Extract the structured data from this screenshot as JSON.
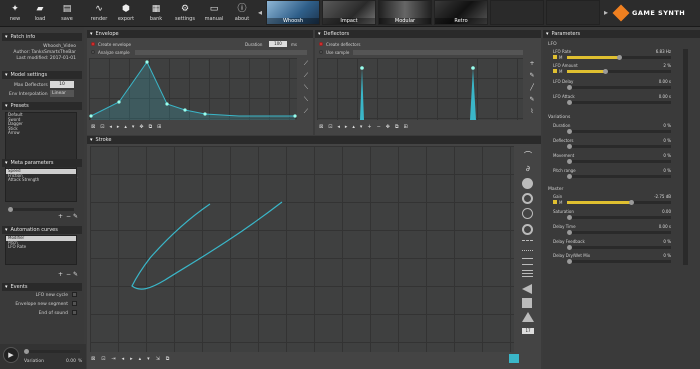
{
  "toolbar": {
    "buttons": [
      {
        "label": "new",
        "icon": "✦"
      },
      {
        "label": "load",
        "icon": "▰"
      },
      {
        "label": "save",
        "icon": "▤"
      },
      {
        "label": "render",
        "icon": "∿"
      },
      {
        "label": "export",
        "icon": "⬢"
      },
      {
        "label": "bank",
        "icon": "▦"
      },
      {
        "label": "settings",
        "icon": "⚙"
      },
      {
        "label": "manual",
        "icon": "▭"
      },
      {
        "label": "about",
        "icon": "ⓘ"
      }
    ],
    "categories": [
      "Whoosh",
      "Impact",
      "Modular",
      "Retro"
    ],
    "brand": "GAME SYNTH"
  },
  "patch_info": {
    "title": "Patch info",
    "name": "Whoosh_Video",
    "author": "Author: TanksSmartsTheBar",
    "modified": "Last modified: 2017-01-01"
  },
  "model_settings": {
    "title": "Model settings",
    "max_deflectors_label": "Max Deflectors",
    "max_deflectors_value": "10",
    "env_interp_label": "Env Interpolation",
    "env_interp_value": "Linear"
  },
  "presets": {
    "title": "Presets",
    "items": [
      "Default",
      "Sword",
      "Dagger",
      "Stick",
      "Arrow"
    ]
  },
  "meta": {
    "title": "Meta parameters",
    "items": [
      "Speed",
      "Friction",
      "Attack Strength"
    ]
  },
  "automation": {
    "title": "Automation curves",
    "items": [
      "Modifier",
      "Pitch",
      "LFO Rate"
    ]
  },
  "events": {
    "title": "Events",
    "items": [
      "LFO new cycle",
      "Envelope new segment",
      "End of sound"
    ]
  },
  "footer": {
    "variation_label": "Variation",
    "variation_value": "0.00",
    "variation_unit": "%"
  },
  "envelope": {
    "title": "Envelope",
    "create_label": "Create envelope",
    "analyze_label": "Analyze sample",
    "duration_label": "Duration",
    "duration_value": "100",
    "duration_unit": "ms"
  },
  "deflectors": {
    "title": "Deflectors",
    "create_label": "Create deflectors",
    "use_label": "Use sample"
  },
  "stroke": {
    "title": "Stroke",
    "zoom_value": "17"
  },
  "parameters": {
    "title": "Parameters",
    "lfo_title": "LFO",
    "lfo": [
      {
        "label": "LFO Rate",
        "value": "6.83 Hz"
      },
      {
        "label": "LFO Amount",
        "value": "2 %"
      },
      {
        "label": "LFO Delay",
        "value": "0.00 s"
      },
      {
        "label": "LFO Attack",
        "value": "0.00 s"
      }
    ],
    "variations_title": "Variations",
    "variations": [
      {
        "label": "Duration",
        "value": "0 %"
      },
      {
        "label": "Deflectors",
        "value": "0 %"
      },
      {
        "label": "Movement",
        "value": "0 %"
      },
      {
        "label": "Pitch range",
        "value": "0 %"
      }
    ],
    "master_title": "Master",
    "master": [
      {
        "label": "Gain",
        "value": "-2.75 dB"
      },
      {
        "label": "Saturation",
        "value": "0.00"
      },
      {
        "label": "Delay Time",
        "value": "0.00 s"
      },
      {
        "label": "Delay Feedback",
        "value": "0 %"
      },
      {
        "label": "Delay Dry/Wet Mix",
        "value": "0 %"
      }
    ],
    "m_label": "M"
  },
  "colors": {
    "accent": "#3ab6c8",
    "toggle": "#e0c030",
    "brand_orange": "#f08020"
  }
}
